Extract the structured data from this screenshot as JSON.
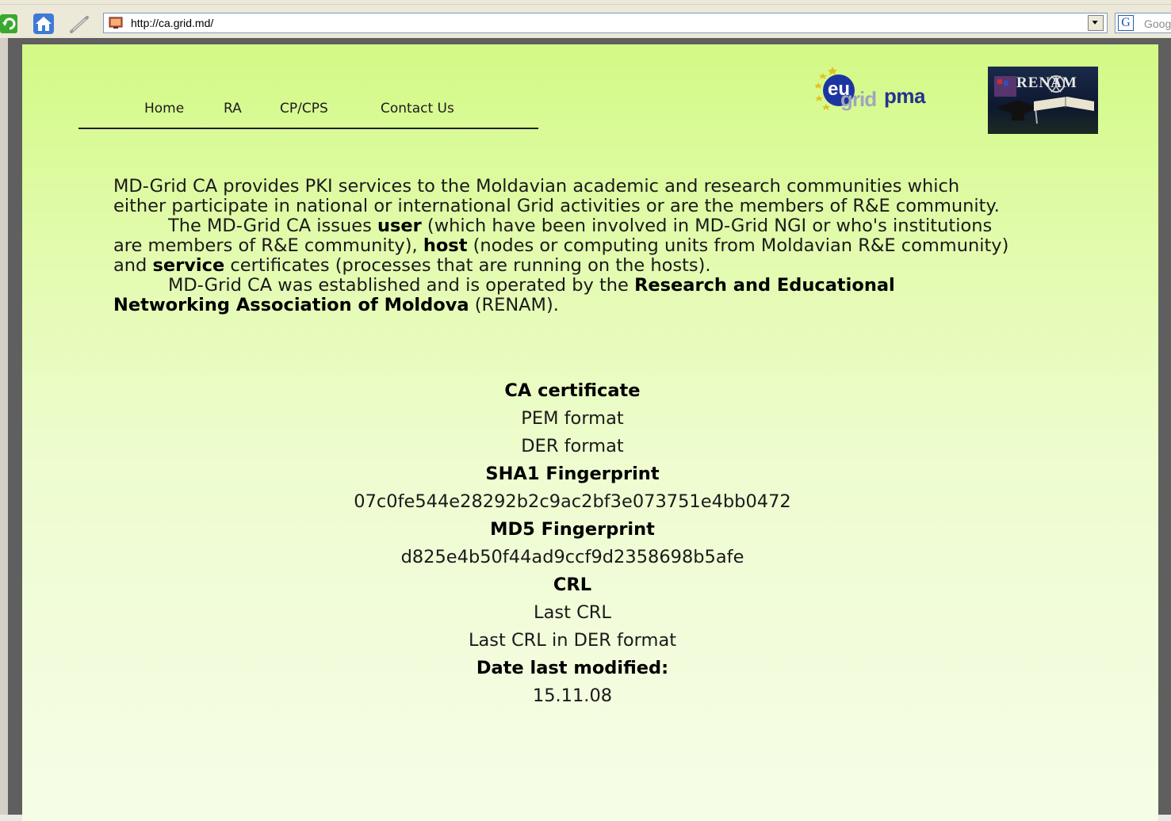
{
  "browser": {
    "url": "http://ca.grid.md/",
    "search_placeholder": "Google",
    "icons": [
      "reload-icon",
      "home-icon",
      "pen-icon",
      "site-icon",
      "chevron-down-icon",
      "google-icon"
    ]
  },
  "nav": {
    "home": "Home",
    "ra": "RA",
    "cpcps": "CP/CPS",
    "contact": "Contact Us"
  },
  "logos": {
    "eugrid_eu": "eu",
    "eugrid_grid": "grid",
    "eugrid_pma": "pma",
    "renam": "RENAM"
  },
  "intro": {
    "p1": "MD-Grid CA provides PKI services to the Moldavian academic and research communities which either participate in national or international Grid activities or are the members of R&E community.",
    "p2_pre": "The MD-Grid CA issues ",
    "p2_user": "user",
    "p2_user_desc": " (which have been involved in MD-Grid NGI or who's institutions are members of R&E community), ",
    "p2_host": "host",
    "p2_host_desc": " (nodes or computing units from Moldavian R&E community) and ",
    "p2_service": "service",
    "p2_service_desc": " certificates (processes that are running on the hosts).",
    "p3_pre": "MD-Grid CA was established and is operated by the ",
    "p3_org": "Research and Educational Networking Association of Moldova",
    "p3_post": " (RENAM)."
  },
  "cert": {
    "ca_certificate_heading": "CA certificate",
    "pem_link": "PEM format",
    "der_link": "DER format",
    "sha1_heading": "SHA1 Fingerprint",
    "sha1_value": "07c0fe544e28292b2c9ac2bf3e073751e4bb0472",
    "md5_heading": "MD5 Fingerprint",
    "md5_value": "d825e4b50f44ad9ccf9d2358698b5afe",
    "crl_heading": "CRL",
    "last_crl_link": "Last CRL",
    "last_crl_der_link": "Last CRL in DER format",
    "date_heading": "Date last modified:",
    "date_value": "15.11.08"
  },
  "colors": {
    "page_gradient_top": "#d3f985",
    "page_gradient_bottom": "#f6fde7",
    "text": "#1a1a1a",
    "eugrid_blue": "#1d35a0"
  }
}
